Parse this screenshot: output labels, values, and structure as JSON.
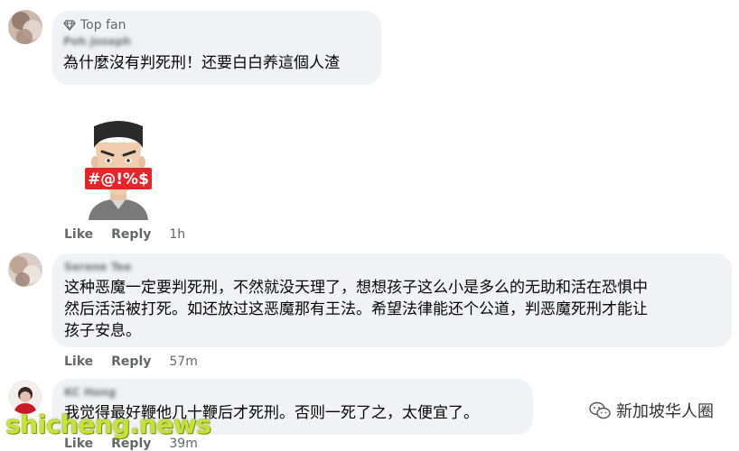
{
  "comments": [
    {
      "badge": "Top fan",
      "author": "Poh Joseph",
      "text": "為什麼沒有判死刑！还要白白养這個人渣",
      "actions": {
        "like": "Like",
        "reply": "Reply",
        "time": "1h"
      }
    },
    {
      "author": "Serene Tee",
      "text": "这种恶魔一定要判死刑，不然就没天理了，想想孩子这么小是多么的无助和活在恐惧中\n然后活活被打死。如还放过这恶魔那有王法。希望法律能还个公道，判恶魔死刑才能让\n孩子安息。",
      "actions": {
        "like": "Like",
        "reply": "Reply",
        "time": "57m"
      }
    },
    {
      "author": "KC Hong",
      "text": "我觉得最好鞭他几十鞭后才死刑。否则一死了之，太便宜了。",
      "actions": {
        "like": "Like",
        "reply": "Reply",
        "time": "39m"
      }
    }
  ],
  "sticker": {
    "text": "#@!%$"
  },
  "watermark": {
    "label": "新加坡华人圈"
  },
  "site_mark": "shicheng.news",
  "colors": {
    "bubble": "#f0f2f5",
    "meta": "#65676b",
    "text": "#050505",
    "sticker_red": "#e3262a"
  }
}
